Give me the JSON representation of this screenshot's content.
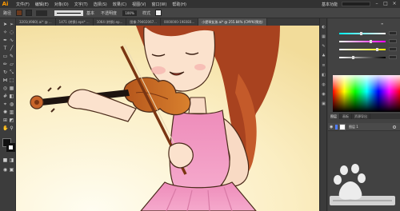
{
  "app": {
    "logo": "Ai"
  },
  "menu": [
    "文件(F)",
    "编辑(E)",
    "对象(O)",
    "文字(T)",
    "选择(S)",
    "效果(C)",
    "视图(V)",
    "窗口(W)",
    "帮助(H)"
  ],
  "workspace": "基本功能",
  "controlbar": {
    "selection": "路径",
    "stroke_weight": "基本",
    "opacity_label": "不透明度",
    "opacity": "100%",
    "style_label": "样式"
  },
  "tabs": [
    {
      "label": "3201(4980).ai* @ ..."
    },
    {
      "label": "1471 (转换).eps* ..."
    },
    {
      "label": "1064 (转换).ep..."
    },
    {
      "label": "图像-79402067..."
    },
    {
      "label": "0000000-19E0E6..."
    },
    {
      "label": "小提琴女孩.ai* @ 255.84% (CMYK/预览)"
    }
  ],
  "panels": {
    "tabs": [
      "图层",
      "画板",
      "资源导出"
    ],
    "layer_name": "图层 1"
  },
  "colors": {
    "accent": "#ff9a00",
    "canvas_top": "#f5e6b3",
    "canvas_bottom": "#fffbea"
  }
}
